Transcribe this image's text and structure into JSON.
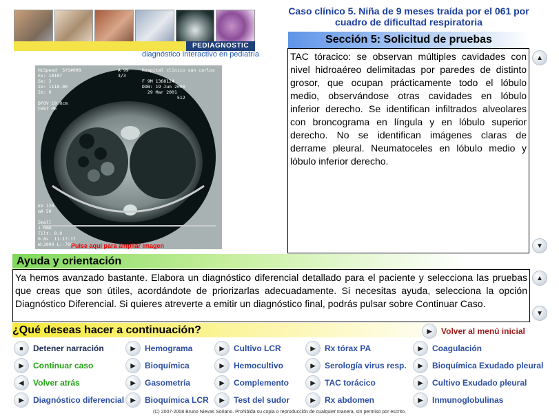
{
  "header": {
    "brand": "PEDIAGNOSTIC",
    "tagline": "diagnóstico interactivo en pediatría",
    "case_title": "Caso clínico 5. Niña de 9 meses traída por el 061 por cuadro de dificultad respiratoria"
  },
  "section": {
    "title": "Sección 5: Solicitud de pruebas",
    "description": "TAC tóracico: se observan múltiples cavidades con nivel hidroaéreo delimitadas por paredes de distinto grosor, que ocupan prácticamente todo el lóbulo medio, observándose otras cavidades en lóbulo inferior derecho. Se identifican infiltrados alveolares con broncograma en língula y en lóbulo superior derecho. No se identifican imágenes claras de derrame pleural. Neumatoceles en lóbulo medio y lóbulo inferior derecho."
  },
  "image": {
    "caption": "Pulse aquí para ampliar imagen",
    "overlay_top_left": "HiSpeed  SYS#008\nEx: 10107\nSe: 2\nIm: 1118.00\nIm: 0\n\nDFOV 19.8cm\nCHST PE",
    "overlay_top_center": "A 99\n3/3",
    "overlay_top_right": "hospital clinico san carlos\n\nF 9M 1368124\nDOB: 19 Jun 2000\n  29 Mar 2001\n             512",
    "overlay_bottom_left": "kV 120\nmA 50\n\nSmall\n1.0mm\nTilt: 0.0\n0.8s  11:17:17\nW:2000 L:-700"
  },
  "help": {
    "title": "Ayuda y orientación",
    "text": "Ya hemos avanzado bastante. Elabora un diagnóstico diferencial detallado para el paciente y selecciona las pruebas que creas que son útiles, acordándote de priorizarlas adecuadamente. Si necesitas ayuda, selecciona la opción Diagnóstico Diferencial. Si quieres atreverte a emitir un diagnóstico final, podrás pulsar sobre Continuar Caso."
  },
  "next": {
    "title": "¿Qué deseas hacer a continuación?",
    "menu_label": "Volver al menú inicial"
  },
  "actions": {
    "col1": [
      "Detener narración",
      "Continuar caso",
      "Volver atrás",
      "Diagnóstico diferencial"
    ],
    "col2": [
      "Hemograma",
      "Bioquímica",
      "Gasometría",
      "Bioquímica LCR"
    ],
    "col3": [
      "Cultivo LCR",
      "Hemocultivo",
      "Complemento",
      "Test del sudor"
    ],
    "col4": [
      "Rx tórax PA",
      "Serología virus resp.",
      "TAC torácico",
      "Rx abdomen"
    ],
    "col5": [
      "Coagulación",
      "Bioquímica Exudado pleural",
      "Cultivo Exudado pleural",
      "Inmunoglobulinas"
    ]
  },
  "copyright": "(C) 2007-2008 Bruno Nievas Soriano. Prohibida su copia o reproducción de cualquier manera, sin permiso por escrito.",
  "colors": {
    "title_blue": "#1b3e9a",
    "link_blue": "#2b4da3",
    "green": "#22a514",
    "red": "#9a1a1a"
  }
}
